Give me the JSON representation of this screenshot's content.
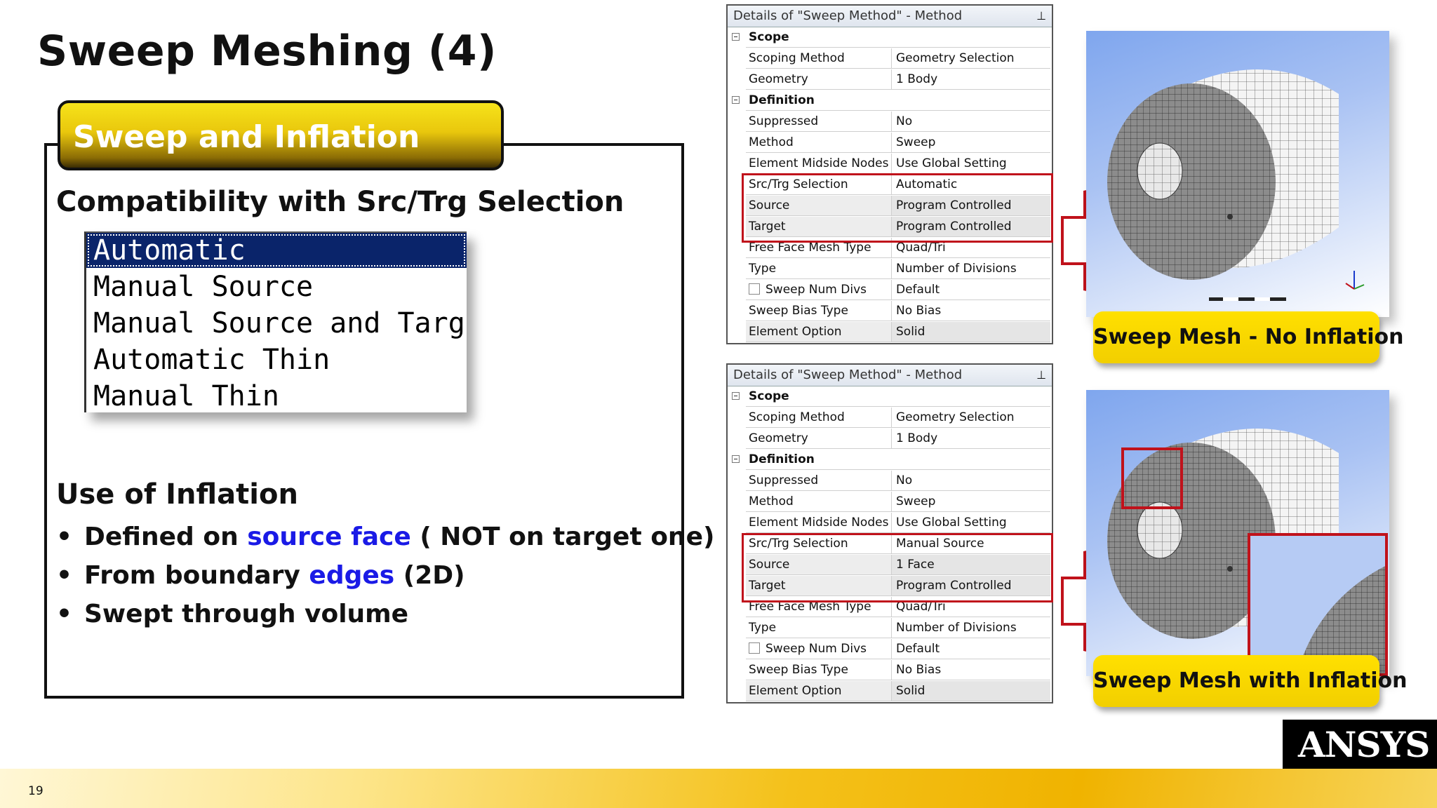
{
  "slide": {
    "title": "Sweep Meshing (4)",
    "page_number": "19"
  },
  "section": {
    "banner": "Sweep and Inflation",
    "compat_heading": "Compatibility with Src/Trg Selection",
    "listbox": {
      "options": [
        "Automatic",
        "Manual Source",
        "Manual Source and Target",
        "Automatic Thin",
        "Manual Thin"
      ],
      "selected": "Automatic"
    },
    "inflation_heading": "Use of Inflation",
    "bullets": [
      {
        "pre": "Defined on ",
        "hl": "source face",
        "post": " ( NOT on target one)"
      },
      {
        "pre": "From boundary ",
        "hl": "edges",
        "post": " (2D)"
      },
      {
        "pre": "Swept through volume",
        "hl": "",
        "post": ""
      }
    ]
  },
  "panels": [
    {
      "header": "Details of \"Sweep Method\" - Method",
      "rows": [
        {
          "k": "Scope",
          "cat": true
        },
        {
          "k": "Scoping Method",
          "v": "Geometry Selection"
        },
        {
          "k": "Geometry",
          "v": "1 Body"
        },
        {
          "k": "Definition",
          "cat": true
        },
        {
          "k": "Suppressed",
          "v": "No"
        },
        {
          "k": "Method",
          "v": "Sweep"
        },
        {
          "k": "Element Midside Nodes",
          "v": "Use Global Setting"
        },
        {
          "k": "Src/Trg Selection",
          "v": "Automatic"
        },
        {
          "k": "Source",
          "v": "Program Controlled"
        },
        {
          "k": "Target",
          "v": "Program Controlled"
        },
        {
          "k": "Free Face Mesh Type",
          "v": "Quad/Tri"
        },
        {
          "k": "Type",
          "v": "Number of Divisions"
        },
        {
          "k": "Sweep Num Divs",
          "v": "Default"
        },
        {
          "k": "Sweep Bias Type",
          "v": "No Bias"
        },
        {
          "k": "Element Option",
          "v": "Solid"
        }
      ]
    },
    {
      "header": "Details of \"Sweep Method\" - Method",
      "rows": [
        {
          "k": "Scope",
          "cat": true
        },
        {
          "k": "Scoping Method",
          "v": "Geometry Selection"
        },
        {
          "k": "Geometry",
          "v": "1 Body"
        },
        {
          "k": "Definition",
          "cat": true
        },
        {
          "k": "Suppressed",
          "v": "No"
        },
        {
          "k": "Method",
          "v": "Sweep"
        },
        {
          "k": "Element Midside Nodes",
          "v": "Use Global Setting"
        },
        {
          "k": "Src/Trg Selection",
          "v": "Manual Source"
        },
        {
          "k": "Source",
          "v": "1 Face"
        },
        {
          "k": "Target",
          "v": "Program Controlled"
        },
        {
          "k": "Free Face Mesh Type",
          "v": "Quad/Tri"
        },
        {
          "k": "Type",
          "v": "Number of Divisions"
        },
        {
          "k": "Sweep Num Divs",
          "v": "Default"
        },
        {
          "k": "Sweep Bias Type",
          "v": "No Bias"
        },
        {
          "k": "Element Option",
          "v": "Solid"
        }
      ]
    }
  ],
  "captions": {
    "no_inflation": "Sweep Mesh - No Inflation",
    "with_inflation": "Sweep Mesh with Inflation"
  },
  "brand": {
    "logo": "ANSYS",
    "accent_color": "#f4c11a",
    "highlight_color": "#c0121b",
    "link_color": "#1a1ae6"
  },
  "icons": [
    "pin-icon",
    "collapse-icon",
    "checkbox-icon",
    "axis-triad-icon",
    "arrow-right-icon"
  ]
}
